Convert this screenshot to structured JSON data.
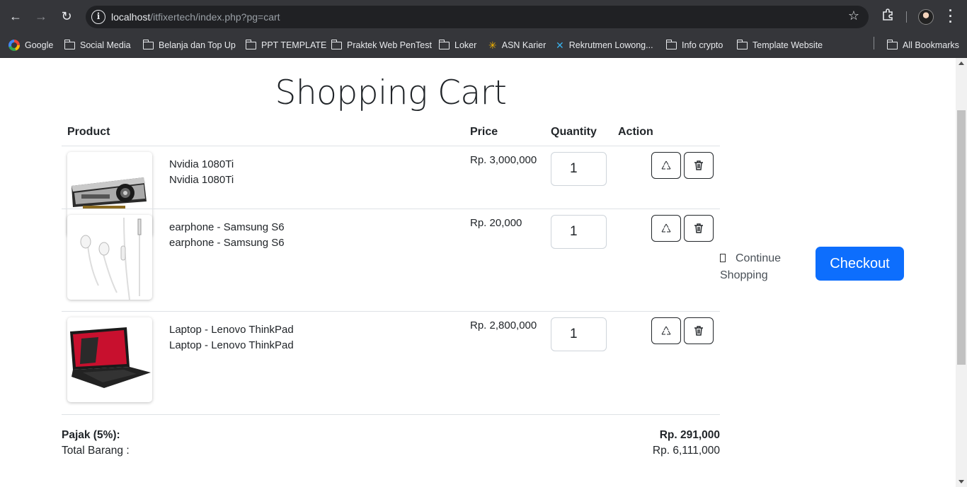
{
  "browser": {
    "url_host": "localhost",
    "url_path": "/itfixertech/index.php?pg=cart",
    "bookmarks": [
      "Google",
      "Social Media",
      "Belanja dan Top Up",
      "PPT TEMPLATE",
      "Praktek Web PenTest",
      "Loker",
      "ASN Karier",
      "Rekrutmen Lowong...",
      "Info crypto",
      "Template Website"
    ],
    "all_bookmarks": "All Bookmarks"
  },
  "page": {
    "title": "Shopping Cart",
    "headers": {
      "product": "Product",
      "price": "Price",
      "quantity": "Quantity",
      "action": "Action"
    },
    "items": [
      {
        "name": "Nvidia 1080Ti",
        "subname": "Nvidia 1080Ti",
        "price": "Rp. 3,000,000",
        "qty": "1"
      },
      {
        "name": "earphone - Samsung S6",
        "subname": "earphone - Samsung S6",
        "price": "Rp. 20,000",
        "qty": "1"
      },
      {
        "name": "Laptop - Lenovo ThinkPad",
        "subname": "Laptop - Lenovo ThinkPad",
        "price": "Rp. 2,800,000",
        "qty": "1"
      }
    ],
    "continue_label": "Continue Shopping",
    "checkout_label": "Checkout",
    "tax_label": "Pajak (5%):",
    "tax_value": "Rp. 291,000",
    "total_label": "Total Barang :",
    "total_value": "Rp. 6,111,000",
    "accent_color": "#0d6efd"
  }
}
